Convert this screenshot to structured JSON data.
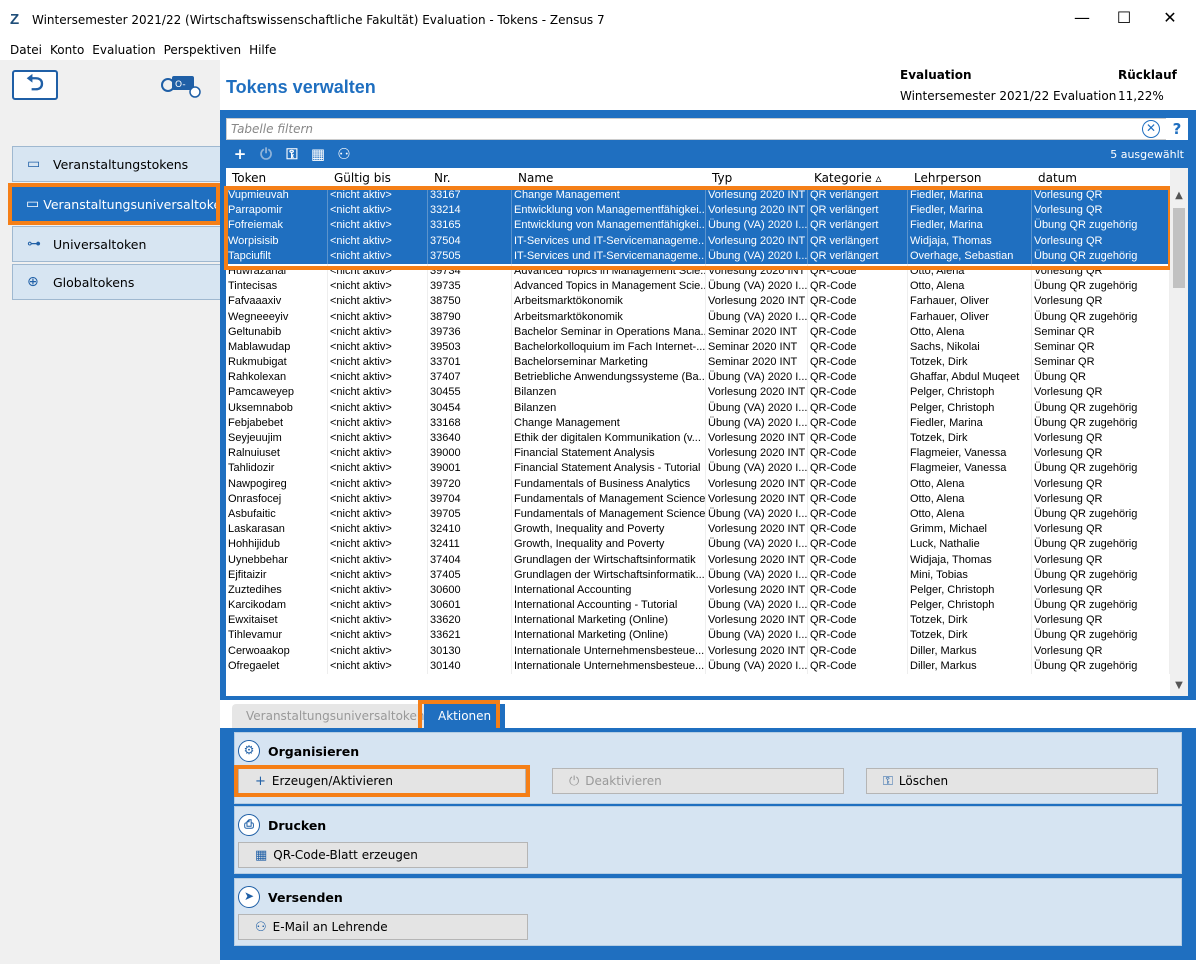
{
  "window": {
    "title": "Wintersemester 2021/22 (Wirtschaftswissenschaftliche Fakultät) Evaluation - Tokens - Zensus 7",
    "minimize": "—",
    "maximize": "☐",
    "close": "✕",
    "app_icon": "Z"
  },
  "menu": [
    "Datei",
    "Konto",
    "Evaluation",
    "Perspektiven",
    "Hilfe"
  ],
  "sidebar": {
    "items": [
      {
        "label": "Veranstaltungstokens",
        "icon": "veranstaltung-icon"
      },
      {
        "label": "Veranstaltungsuniversaltokens",
        "icon": "universal-veranstaltung-icon"
      },
      {
        "label": "Universaltoken",
        "icon": "hierarchy-icon"
      },
      {
        "label": "Globaltokens",
        "icon": "global-key-icon"
      }
    ]
  },
  "header": {
    "title": "Tokens verwalten",
    "evaluation_label": "Evaluation",
    "evaluation_value": "Wintersemester 2021/22 Evaluation",
    "ruecklauf_label": "Rücklauf",
    "ruecklauf_value": "11,22%"
  },
  "filter": {
    "placeholder": "Tabelle filtern"
  },
  "toolbar": {
    "selected_count": "5 ausgewählt"
  },
  "table": {
    "columns": [
      "Token",
      "Gültig bis",
      "Nr.",
      "Name",
      "Typ",
      "Kategorie ▵",
      "Lehrperson",
      "datum"
    ],
    "rows": [
      [
        "Vupmieuvah",
        "<nicht aktiv>",
        "33167",
        "Change Management",
        "Vorlesung 2020 INT",
        "QR verlängert",
        "Fiedler, Marina",
        "Vorlesung QR"
      ],
      [
        "Parrapomir",
        "<nicht aktiv>",
        "33214",
        "Entwicklung von Managementfähigkei...",
        "Vorlesung 2020 INT",
        "QR verlängert",
        "Fiedler, Marina",
        "Vorlesung QR"
      ],
      [
        "Fofreiemak",
        "<nicht aktiv>",
        "33165",
        "Entwicklung von Managementfähigkei...",
        "Übung (VA) 2020 I...",
        "QR verlängert",
        "Fiedler, Marina",
        "Übung QR zugehörig"
      ],
      [
        "Worpisisib",
        "<nicht aktiv>",
        "37504",
        "IT-Services und IT-Servicemanageme...",
        "Vorlesung 2020 INT",
        "QR verlängert",
        "Widjaja, Thomas",
        "Vorlesung QR"
      ],
      [
        "Tapciufilt",
        "<nicht aktiv>",
        "37505",
        "IT-Services und IT-Servicemanageme...",
        "Übung (VA) 2020 I...",
        "QR verlängert",
        "Overhage, Sebastian",
        "Übung QR zugehörig"
      ],
      [
        "Huwrazanal",
        "<nicht aktiv>",
        "39734",
        "Advanced Topics in Management Scie...",
        "Vorlesung 2020 INT",
        "QR-Code",
        "Otto, Alena",
        "Vorlesung QR"
      ],
      [
        "Tintecisas",
        "<nicht aktiv>",
        "39735",
        "Advanced Topics in Management Scie...",
        "Übung (VA) 2020 I...",
        "QR-Code",
        "Otto, Alena",
        "Übung QR zugehörig"
      ],
      [
        "Fafvaaaxiv",
        "<nicht aktiv>",
        "38750",
        "Arbeitsmarktökonomik",
        "Vorlesung 2020 INT",
        "QR-Code",
        "Farhauer, Oliver",
        "Vorlesung QR"
      ],
      [
        "Wegneeeyiv",
        "<nicht aktiv>",
        "38790",
        "Arbeitsmarktökonomik",
        "Übung (VA) 2020 I...",
        "QR-Code",
        "Farhauer, Oliver",
        "Übung QR zugehörig"
      ],
      [
        "Geltunabib",
        "<nicht aktiv>",
        "39736",
        "Bachelor Seminar in Operations Mana...",
        "Seminar 2020 INT",
        "QR-Code",
        "Otto, Alena",
        "Seminar QR"
      ],
      [
        "Mablawudap",
        "<nicht aktiv>",
        "39503",
        "Bachelorkolloquium im Fach Internet-...",
        "Seminar 2020 INT",
        "QR-Code",
        "Sachs, Nikolai",
        "Seminar QR"
      ],
      [
        "Rukmubigat",
        "<nicht aktiv>",
        "33701",
        "Bachelorseminar Marketing",
        "Seminar 2020 INT",
        "QR-Code",
        "Totzek, Dirk",
        "Seminar QR"
      ],
      [
        "Rahkolexan",
        "<nicht aktiv>",
        "37407",
        "Betriebliche Anwendungssysteme (Ba...",
        "Übung (VA) 2020 I...",
        "QR-Code",
        "Ghaffar, Abdul Muqeet",
        "Übung QR"
      ],
      [
        "Pamcaweyep",
        "<nicht aktiv>",
        "30455",
        "Bilanzen",
        "Vorlesung 2020 INT",
        "QR-Code",
        "Pelger, Christoph",
        "Vorlesung QR"
      ],
      [
        "Uksemnabob",
        "<nicht aktiv>",
        "30454",
        "Bilanzen",
        "Übung (VA) 2020 I...",
        "QR-Code",
        "Pelger, Christoph",
        "Übung QR zugehörig"
      ],
      [
        "Febjabebet",
        "<nicht aktiv>",
        "33168",
        "Change Management",
        "Übung (VA) 2020 I...",
        "QR-Code",
        "Fiedler, Marina",
        "Übung QR zugehörig"
      ],
      [
        "Seyjeuujim",
        "<nicht aktiv>",
        "33640",
        "Ethik der digitalen Kommunikation (v...",
        "Vorlesung 2020 INT",
        "QR-Code",
        "Totzek, Dirk",
        "Vorlesung QR"
      ],
      [
        "Ralnuiuset",
        "<nicht aktiv>",
        "39000",
        "Financial Statement Analysis",
        "Vorlesung 2020 INT",
        "QR-Code",
        "Flagmeier, Vanessa",
        "Vorlesung QR"
      ],
      [
        "Tahlidozir",
        "<nicht aktiv>",
        "39001",
        "Financial Statement Analysis - Tutorial",
        "Übung (VA) 2020 I...",
        "QR-Code",
        "Flagmeier, Vanessa",
        "Übung QR zugehörig"
      ],
      [
        "Nawpogireg",
        "<nicht aktiv>",
        "39720",
        "Fundamentals of Business Analytics",
        "Vorlesung 2020 INT",
        "QR-Code",
        "Otto, Alena",
        "Vorlesung QR"
      ],
      [
        "Onrasfocej",
        "<nicht aktiv>",
        "39704",
        "Fundamentals of Management Science",
        "Vorlesung 2020 INT",
        "QR-Code",
        "Otto, Alena",
        "Vorlesung QR"
      ],
      [
        "Asbufaitic",
        "<nicht aktiv>",
        "39705",
        "Fundamentals of Management Science",
        "Übung (VA) 2020 I...",
        "QR-Code",
        "Otto, Alena",
        "Übung QR zugehörig"
      ],
      [
        "Laskarasan",
        "<nicht aktiv>",
        "32410",
        "Growth, Inequality and Poverty",
        "Vorlesung 2020 INT",
        "QR-Code",
        "Grimm, Michael",
        "Vorlesung QR"
      ],
      [
        "Hohhijidub",
        "<nicht aktiv>",
        "32411",
        "Growth, Inequality and Poverty",
        "Übung (VA) 2020 I...",
        "QR-Code",
        "Luck, Nathalie",
        "Übung QR zugehörig"
      ],
      [
        "Uynebbehar",
        "<nicht aktiv>",
        "37404",
        "Grundlagen der Wirtschaftsinformatik",
        "Vorlesung 2020 INT",
        "QR-Code",
        "Widjaja, Thomas",
        "Vorlesung QR"
      ],
      [
        "Ejfitaizir",
        "<nicht aktiv>",
        "37405",
        "Grundlagen der Wirtschaftsinformatik...",
        "Übung (VA) 2020 I...",
        "QR-Code",
        "Mini, Tobias",
        "Übung QR zugehörig"
      ],
      [
        "Zuztedihes",
        "<nicht aktiv>",
        "30600",
        "International Accounting",
        "Vorlesung 2020 INT",
        "QR-Code",
        "Pelger, Christoph",
        "Vorlesung QR"
      ],
      [
        "Karcikodam",
        "<nicht aktiv>",
        "30601",
        "International Accounting - Tutorial",
        "Übung (VA) 2020 I...",
        "QR-Code",
        "Pelger, Christoph",
        "Übung QR zugehörig"
      ],
      [
        "Ewxitaiset",
        "<nicht aktiv>",
        "33620",
        "International Marketing (Online)",
        "Vorlesung 2020 INT",
        "QR-Code",
        "Totzek, Dirk",
        "Vorlesung QR"
      ],
      [
        "Tihlevamur",
        "<nicht aktiv>",
        "33621",
        "International Marketing (Online)",
        "Übung (VA) 2020 I...",
        "QR-Code",
        "Totzek, Dirk",
        "Übung QR zugehörig"
      ],
      [
        "Cerwoaakop",
        "<nicht aktiv>",
        "30130",
        "Internationale Unternehmensbesteue...",
        "Vorlesung 2020 INT",
        "QR-Code",
        "Diller, Markus",
        "Vorlesung QR"
      ],
      [
        "Ofregaelet",
        "<nicht aktiv>",
        "30140",
        "Internationale Unternehmensbesteue...",
        "Übung (VA) 2020 I...",
        "QR-Code",
        "Diller, Markus",
        "Übung QR zugehörig"
      ]
    ],
    "selected_rows": 5
  },
  "tabs": [
    {
      "label": "Veranstaltungsuniversaltokens"
    },
    {
      "label": "Aktionen"
    }
  ],
  "actions": {
    "organisieren": {
      "title": "Organisieren",
      "create": "Erzeugen/Aktivieren",
      "deactivate": "Deaktivieren",
      "delete": "Löschen"
    },
    "drucken": {
      "title": "Drucken",
      "qr": "QR-Code-Blatt erzeugen"
    },
    "versenden": {
      "title": "Versenden",
      "email": "E-Mail an Lehrende"
    }
  },
  "colors": {
    "accent": "#1f6fc0",
    "highlight": "#f57f17",
    "panel": "#d6e4f2"
  }
}
